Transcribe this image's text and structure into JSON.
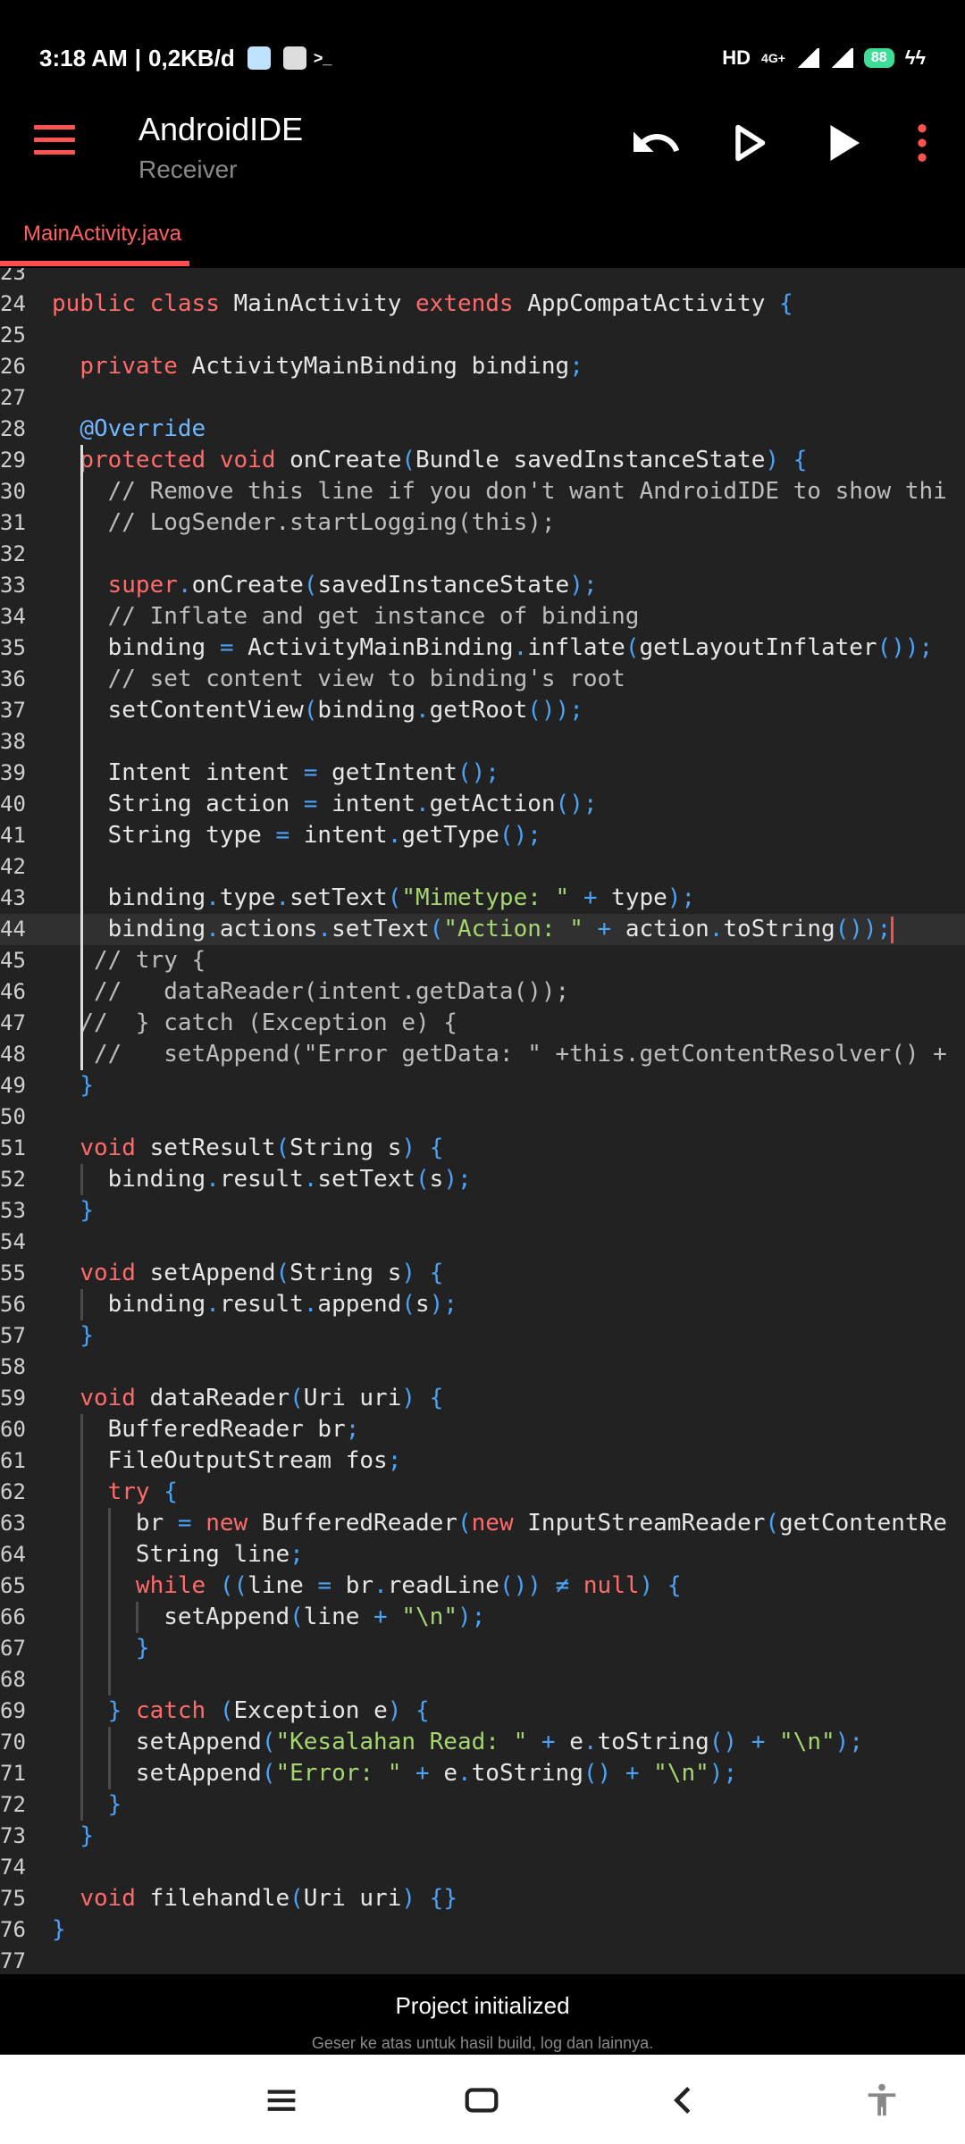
{
  "status_bar": {
    "time": "3:18 AM",
    "net_speed": "0,2KB/d",
    "hd": "HD",
    "network": "4G+",
    "battery": "88"
  },
  "app_bar": {
    "title": "AndroidIDE",
    "subtitle": "Receiver",
    "icons": [
      "menu-icon",
      "undo-icon",
      "run-outline-icon",
      "run-icon",
      "more-vert-icon"
    ]
  },
  "tabs": [
    {
      "label": "MainActivity.java",
      "active": true
    }
  ],
  "editor": {
    "current_line": "44",
    "lines": [
      {
        "n": "23",
        "t": ""
      },
      {
        "n": "24",
        "t": "public class MainActivity extends AppCompatActivity {"
      },
      {
        "n": "25",
        "t": ""
      },
      {
        "n": "26",
        "t": "  private ActivityMainBinding binding;"
      },
      {
        "n": "27",
        "t": ""
      },
      {
        "n": "28",
        "t": "  @Override"
      },
      {
        "n": "29",
        "t": "  protected void onCreate(Bundle savedInstanceState) {"
      },
      {
        "n": "30",
        "t": "    // Remove this line if you don't want AndroidIDE to show thi"
      },
      {
        "n": "31",
        "t": "    // LogSender.startLogging(this);"
      },
      {
        "n": "32",
        "t": ""
      },
      {
        "n": "33",
        "t": "    super.onCreate(savedInstanceState);"
      },
      {
        "n": "34",
        "t": "    // Inflate and get instance of binding"
      },
      {
        "n": "35",
        "t": "    binding = ActivityMainBinding.inflate(getLayoutInflater());"
      },
      {
        "n": "36",
        "t": "    // set content view to binding's root"
      },
      {
        "n": "37",
        "t": "    setContentView(binding.getRoot());"
      },
      {
        "n": "38",
        "t": ""
      },
      {
        "n": "39",
        "t": "    Intent intent = getIntent();"
      },
      {
        "n": "40",
        "t": "    String action = intent.getAction();"
      },
      {
        "n": "41",
        "t": "    String type = intent.getType();"
      },
      {
        "n": "42",
        "t": ""
      },
      {
        "n": "43",
        "t": "    binding.type.setText(\"Mimetype: \" + type);"
      },
      {
        "n": "44",
        "t": "    binding.actions.setText(\"Action: \" + action.toString());"
      },
      {
        "n": "45",
        "t": "   // try {"
      },
      {
        "n": "46",
        "t": "   //   dataReader(intent.getData());"
      },
      {
        "n": "47",
        "t": "  //  } catch (Exception e) {"
      },
      {
        "n": "48",
        "t": "   //   setAppend(\"Error getData: \" +this.getContentResolver() +"
      },
      {
        "n": "49",
        "t": "  }"
      },
      {
        "n": "50",
        "t": ""
      },
      {
        "n": "51",
        "t": "  void setResult(String s) {"
      },
      {
        "n": "52",
        "t": "    binding.result.setText(s);"
      },
      {
        "n": "53",
        "t": "  }"
      },
      {
        "n": "54",
        "t": ""
      },
      {
        "n": "55",
        "t": "  void setAppend(String s) {"
      },
      {
        "n": "56",
        "t": "    binding.result.append(s);"
      },
      {
        "n": "57",
        "t": "  }"
      },
      {
        "n": "58",
        "t": ""
      },
      {
        "n": "59",
        "t": "  void dataReader(Uri uri) {"
      },
      {
        "n": "60",
        "t": "    BufferedReader br;"
      },
      {
        "n": "61",
        "t": "    FileOutputStream fos;"
      },
      {
        "n": "62",
        "t": "    try {"
      },
      {
        "n": "63",
        "t": "      br = new BufferedReader(new InputStreamReader(getContentRe"
      },
      {
        "n": "64",
        "t": "      String line;"
      },
      {
        "n": "65",
        "t": "      while ((line = br.readLine()) ≠ null) {"
      },
      {
        "n": "66",
        "t": "        setAppend(line + \"\\n\");"
      },
      {
        "n": "67",
        "t": "      }"
      },
      {
        "n": "68",
        "t": ""
      },
      {
        "n": "69",
        "t": "    } catch (Exception e) {"
      },
      {
        "n": "70",
        "t": "      setAppend(\"Kesalahan Read: \" + e.toString() + \"\\n\");"
      },
      {
        "n": "71",
        "t": "      setAppend(\"Error: \" + e.toString() + \"\\n\");"
      },
      {
        "n": "72",
        "t": "    }"
      },
      {
        "n": "73",
        "t": "  }"
      },
      {
        "n": "74",
        "t": ""
      },
      {
        "n": "75",
        "t": "  void filehandle(Uri uri) {}"
      },
      {
        "n": "76",
        "t": "}"
      },
      {
        "n": "77",
        "t": ""
      }
    ]
  },
  "bottom_panel": {
    "toast": "Project initialized",
    "hint": "Geser ke atas untuk hasil build, log dan lainnya."
  },
  "nav_bar": {
    "icons": [
      "recents-icon",
      "home-icon",
      "back-icon",
      "accessibility-icon"
    ]
  },
  "colors": {
    "accent": "#ff4d4d",
    "editor_bg": "#222222",
    "keyword": "#ff6b6b",
    "string": "#a5d66f",
    "punctuation": "#4ba3f7"
  }
}
